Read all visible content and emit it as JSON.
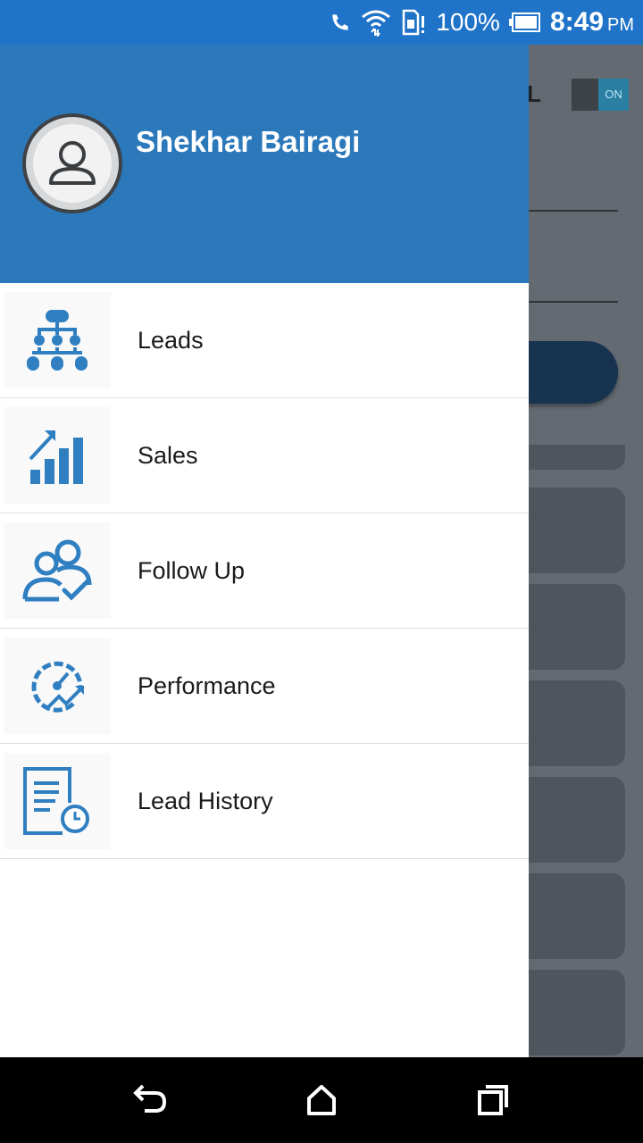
{
  "status_bar": {
    "battery_percent": "100%",
    "time": "8:49",
    "ampm": "PM",
    "icons": [
      "call-icon",
      "wifi-icon",
      "sim-icon",
      "battery-icon"
    ]
  },
  "background_app": {
    "visible_letter": "L",
    "toggle_label": "ON"
  },
  "drawer": {
    "user_name": "Shekhar Bairagi",
    "colors": {
      "header": "#2b78bb",
      "accent_icon": "#2f7fc1"
    },
    "menu": [
      {
        "label": "Leads",
        "icon": "hierarchy-icon"
      },
      {
        "label": "Sales",
        "icon": "growth-chart-icon"
      },
      {
        "label": "Follow Up",
        "icon": "users-check-icon"
      },
      {
        "label": "Performance",
        "icon": "speedometer-icon"
      },
      {
        "label": "Lead History",
        "icon": "document-clock-icon"
      }
    ]
  },
  "nav_bar": {
    "buttons": [
      "back-icon",
      "home-icon",
      "recents-icon"
    ]
  }
}
